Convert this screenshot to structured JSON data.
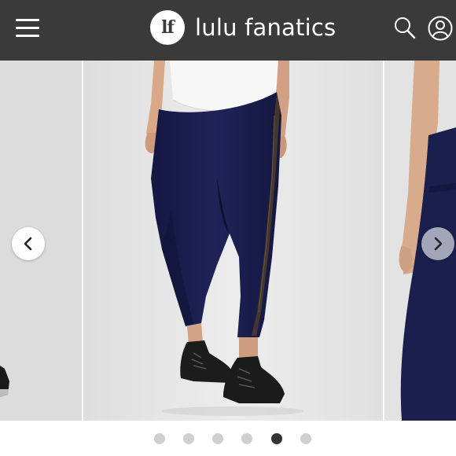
{
  "header": {
    "menu_icon": "hamburger-menu-icon",
    "logo_text": "lf",
    "brand_name": "lulu fanatics",
    "search_icon": "search-icon",
    "profile_icon": "user-profile-icon",
    "background_color": "#3a3a3a"
  },
  "carousel": {
    "previous_icon": "chevron-left-icon",
    "next_icon": "chevron-right-icon",
    "image_count": 6,
    "active_index": 4
  },
  "colors": {
    "dot_inactive": "#cfcfcf",
    "dot_active": "#333333",
    "legging_navy": "#1b1f4e"
  }
}
